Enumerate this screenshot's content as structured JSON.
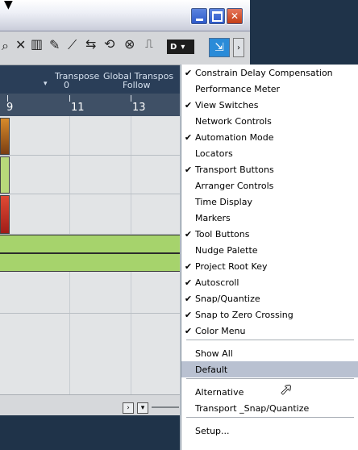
{
  "header": {
    "transpose_label": "Transpose",
    "transpose_value": "0",
    "global_transpose_label": "Global Transpos",
    "global_transpose_value": "Follow"
  },
  "ruler": {
    "bar_9": "9",
    "bar_11": "11",
    "bar_13": "13"
  },
  "toolbar": {
    "dropdown_label": "D"
  },
  "menu": {
    "items": [
      {
        "label": "Constrain Delay Compensation",
        "checked": true
      },
      {
        "label": "Performance Meter",
        "checked": false
      },
      {
        "label": "View Switches",
        "checked": true
      },
      {
        "label": "Network Controls",
        "checked": false
      },
      {
        "label": "Automation Mode",
        "checked": true
      },
      {
        "label": "Locators",
        "checked": false
      },
      {
        "label": "Transport Buttons",
        "checked": true
      },
      {
        "label": "Arranger Controls",
        "checked": false
      },
      {
        "label": "Time Display",
        "checked": false
      },
      {
        "label": "Markers",
        "checked": false
      },
      {
        "label": "Tool Buttons",
        "checked": true
      },
      {
        "label": "Nudge Palette",
        "checked": false
      },
      {
        "label": "Project Root Key",
        "checked": true
      },
      {
        "label": "Autoscroll",
        "checked": true
      },
      {
        "label": "Snap/Quantize",
        "checked": true
      },
      {
        "label": "Snap to Zero Crossing",
        "checked": true
      },
      {
        "label": "Color Menu",
        "checked": true
      },
      {
        "label": "Show All",
        "checked": false
      },
      {
        "label": "Default",
        "checked": false,
        "highlighted": true
      },
      {
        "label": "Alternative",
        "checked": false
      },
      {
        "label": "Transport _Snap/Quantize",
        "checked": false
      },
      {
        "label": "Setup...",
        "checked": false
      }
    ]
  },
  "check_glyph": "✔",
  "colors": {
    "menu_highlight": "#b9c1d1",
    "timeline_green": "#a6d36c",
    "header_blue": "#2a3e58",
    "close_red": "#c23a12"
  }
}
